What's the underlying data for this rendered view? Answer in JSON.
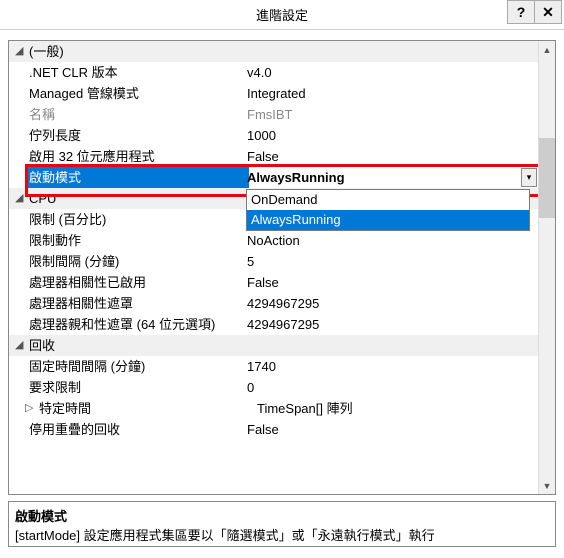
{
  "title": "進階設定",
  "titlebar": {
    "help": "?",
    "close": "✕"
  },
  "categories": {
    "general": {
      "label": "(一般)",
      "items": [
        {
          "label": ".NET CLR 版本",
          "value": "v4.0"
        },
        {
          "label": "Managed 管線模式",
          "value": "Integrated"
        },
        {
          "label": "名稱",
          "value": "FmsIBT",
          "gray": true
        },
        {
          "label": "佇列長度",
          "value": "1000"
        },
        {
          "label": "啟用 32 位元應用程式",
          "value": "False"
        },
        {
          "label": "啟動模式",
          "value": "AlwaysRunning",
          "selected": true
        }
      ]
    },
    "cpu": {
      "label": "CPU",
      "items": [
        {
          "label": "限制 (百分比)",
          "value": ""
        },
        {
          "label": "限制動作",
          "value": "NoAction"
        },
        {
          "label": "限制間隔 (分鐘)",
          "value": "5"
        },
        {
          "label": "處理器相關性已啟用",
          "value": "False"
        },
        {
          "label": "處理器相關性遮罩",
          "value": "4294967295"
        },
        {
          "label": "處理器親和性遮罩 (64 位元選項)",
          "value": "4294967295"
        }
      ]
    },
    "recycle": {
      "label": "回收",
      "items": [
        {
          "label": "固定時間間隔 (分鐘)",
          "value": "1740"
        },
        {
          "label": "要求限制",
          "value": "0"
        },
        {
          "label": "特定時間",
          "value": "TimeSpan[] 陣列",
          "expandable": true
        },
        {
          "label": "停用重疊的回收",
          "value": "False"
        }
      ]
    }
  },
  "dropdown": {
    "options": [
      "OnDemand",
      "AlwaysRunning"
    ],
    "selected": "AlwaysRunning"
  },
  "description": {
    "title": "啟動模式",
    "text": "[startMode] 設定應用程式集區要以「隨選模式」或「永遠執行模式」執行"
  }
}
